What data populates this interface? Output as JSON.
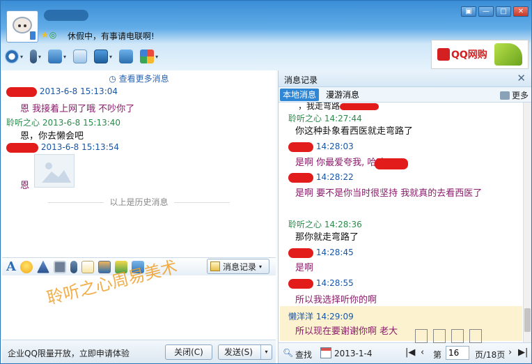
{
  "header": {
    "status_text": "休假中，有事请电联啊!",
    "window_buttons": [
      "▣",
      "—",
      "□",
      "✕"
    ],
    "ad_text": "QQ网购"
  },
  "left": {
    "more_messages": "查看更多消息",
    "messages": [
      {
        "sender": "",
        "time": "2013-6-8 15:13:04",
        "text": "恩 我接着上网了哦 不吵你了"
      },
      {
        "sender": "聆听之心",
        "time": "2013-6-8 15:13:40",
        "text": "恩，你去懒会吧"
      },
      {
        "sender": "",
        "time": "2013-6-8 15:13:54",
        "text": "恩"
      }
    ],
    "history_divider": "以上是历史消息"
  },
  "format_bar": {
    "font_glyph": "A",
    "msg_record_label": "消息记录"
  },
  "input": {
    "watermark": "聆听之心周易美术"
  },
  "bottom": {
    "promo": "企业QQ限量开放，立即申请体验",
    "close_label": "关闭(C)",
    "send_label": "发送(S)"
  },
  "history_panel": {
    "title": "消息记录",
    "tab_local": "本地消息",
    "tab_roam": "漫游消息",
    "more_label": "更多",
    "partial_top": "，我走弯路",
    "messages": [
      {
        "sender": "聆听之心",
        "time": "14:27:44",
        "text": "你这种卦象看西医就走弯路了"
      },
      {
        "sender": "",
        "time": "14:28:03",
        "text": "是啊 你最爱夸我,        哈哈"
      },
      {
        "sender": "",
        "time": "14:28:22",
        "text": "是啊 要不是你当时很坚持 我就真的去看西医了"
      },
      {
        "sender": "聆听之心",
        "time": "14:28:36",
        "text": "那你就走弯路了"
      },
      {
        "sender": "",
        "time": "14:28:45",
        "text": "是啊"
      },
      {
        "sender": "",
        "time": "14:28:55",
        "text": "所以我选择听你的啊"
      },
      {
        "sender": "懒洋洋",
        "time": "14:29:09",
        "text": "所以现在要谢谢你啊 老大"
      }
    ],
    "search_label": "查找",
    "date": "2013-1-4",
    "page_prefix": "第",
    "page_value": "16",
    "page_suffix": "页/18页"
  }
}
